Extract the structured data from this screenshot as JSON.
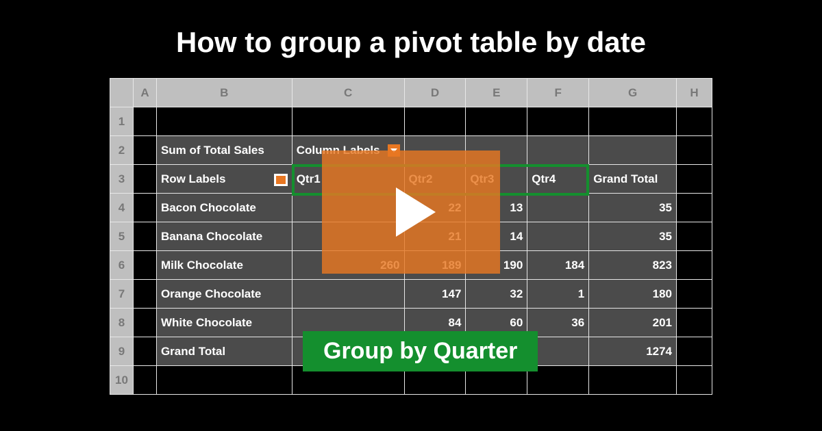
{
  "title": "How to group a pivot table by date",
  "columns": [
    "A",
    "B",
    "C",
    "D",
    "E",
    "F",
    "G",
    "H"
  ],
  "headers": {
    "sum_of": "Sum of Total Sales",
    "col_labels": "Column Labels",
    "row_labels": "Row Labels",
    "grand_total_col": "Grand Total",
    "grand_total_row": "Grand Total"
  },
  "quarters": [
    "Qtr1",
    "Qtr2",
    "Qtr3",
    "Qtr4"
  ],
  "rows": [
    {
      "label": "Bacon Chocolate",
      "q1": "",
      "q2": "22",
      "q3": "13",
      "q4": "",
      "total": "35"
    },
    {
      "label": "Banana Chocolate",
      "q1": "",
      "q2": "21",
      "q3": "14",
      "q4": "",
      "total": "35"
    },
    {
      "label": "Milk Chocolate",
      "q1": "260",
      "q2": "189",
      "q3": "190",
      "q4": "184",
      "total": "823"
    },
    {
      "label": "Orange Chocolate",
      "q1": "",
      "q2": "147",
      "q3": "32",
      "q4": "1",
      "total": "180"
    },
    {
      "label": "White Chocolate",
      "q1": "",
      "q2": "84",
      "q3": "60",
      "q4": "36",
      "total": "201"
    }
  ],
  "grand_totals": {
    "q1": "",
    "q2": "",
    "q3": "",
    "q4": "",
    "total": "1274"
  },
  "caption": "Group by Quarter"
}
